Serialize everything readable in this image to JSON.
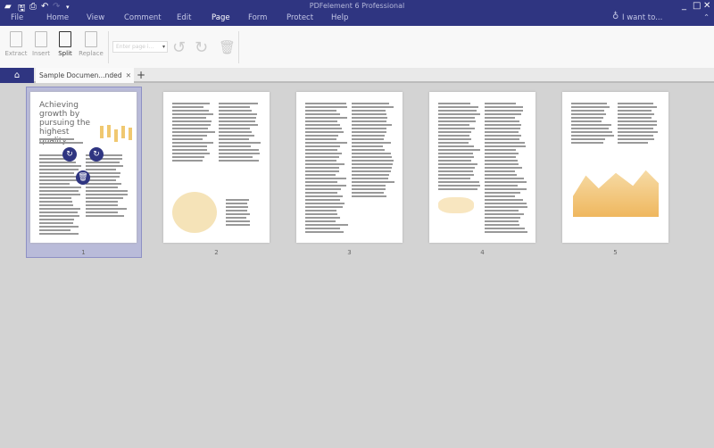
{
  "app": {
    "title": "PDFelement 6 Professional"
  },
  "menu": [
    "File",
    "Home",
    "View",
    "Comment",
    "Edit",
    "Page",
    "Form",
    "Protect",
    "Help"
  ],
  "active_menu": "Page",
  "search": {
    "label": "I want to..."
  },
  "toolbar": {
    "extract": "Extract",
    "insert": "Insert",
    "split": "Split",
    "replace": "Replace",
    "page_placeholder": "Enter page i..."
  },
  "tabs": {
    "document": "Sample Documen...nded"
  },
  "pages": [
    {
      "number": "1",
      "selected": true
    },
    {
      "number": "2"
    },
    {
      "number": "3"
    },
    {
      "number": "4"
    },
    {
      "number": "5"
    }
  ],
  "page1": {
    "headline": "Achieving growth by pursuing the highest quality."
  },
  "colors": {
    "brand": "#2f3581",
    "chart": "#f0c870"
  }
}
